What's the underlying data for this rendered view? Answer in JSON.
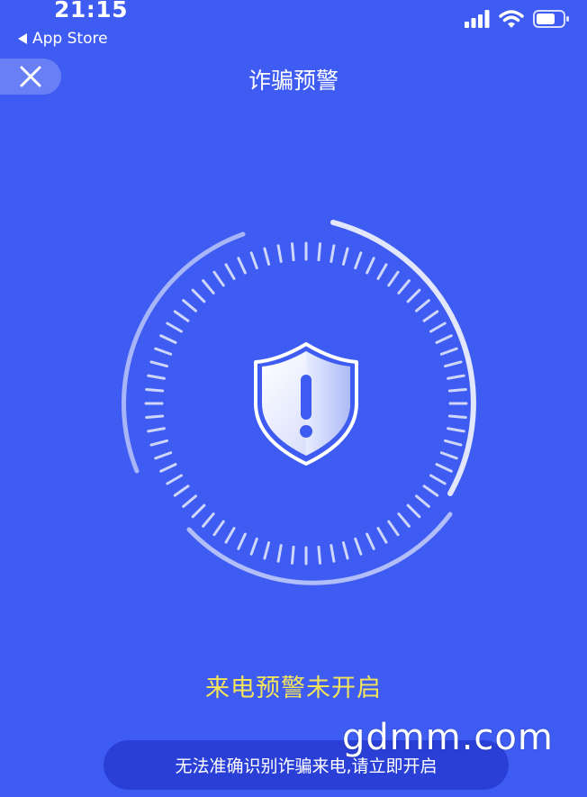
{
  "status_bar": {
    "time": "21:15",
    "back_app": "App Store"
  },
  "header": {
    "title": "诈骗预警"
  },
  "main": {
    "warning_text": "来电预警未开启",
    "enable_button_label": "无法准确识别诈骗来电,请立即开启"
  },
  "watermark": "gdmm.com",
  "colors": {
    "background": "#3f5cf2",
    "warning": "#f4e45a",
    "button": "#2a3fd6"
  },
  "icons": [
    "signal-icon",
    "wifi-icon",
    "battery-icon",
    "close-icon",
    "shield-alert-icon"
  ]
}
